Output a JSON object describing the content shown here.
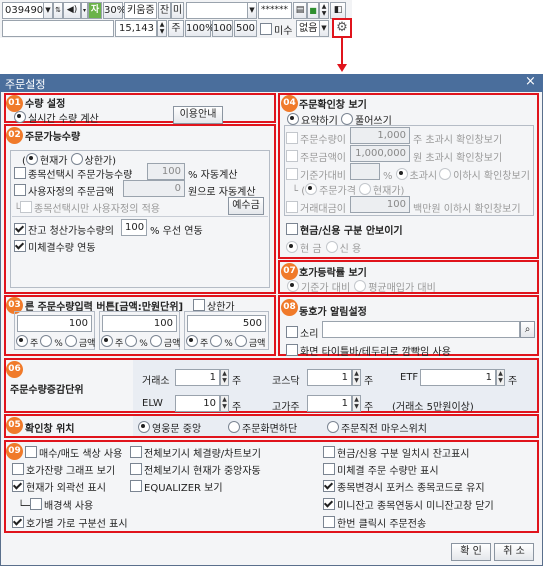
{
  "toolbar": {
    "row1": {
      "account": "039490",
      "pct": "30%",
      "order_qty_label": "키움증",
      "jan": "잔",
      "mi": "미",
      "password": "******"
    },
    "row2": {
      "qty": "15,143",
      "unit": "주",
      "pct100": "100%",
      "q100": "100",
      "q500": "500",
      "unfilled": "미수",
      "none": "없음"
    }
  },
  "dialog": {
    "title": "주문설정",
    "close": "×",
    "s01": {
      "badge": "01",
      "title": "수량 설정",
      "realtime_label": "실시간 수량 계산",
      "usage_button": "이용안내"
    },
    "s02": {
      "badge": "02",
      "title": "주문가능수량",
      "radio_cur": "현재가",
      "radio_upper": "상한가",
      "sel_stock_label": "종목선택시 주문가능수량",
      "sel_stock_value": "100",
      "sel_stock_suffix": "% 자동계산",
      "user_amount_label": "사용자정의 주문금액",
      "user_amount_value": "0",
      "user_amount_suffix": "원으로 자동계산",
      "sub_label": "종목선택시만 사용자정의 적용",
      "sub_button": "예수금",
      "liquidation_label": "잔고 청산가능수량의",
      "liquidation_value": "100",
      "liquidation_suffix": "% 우선 연동",
      "unfilled_label": "미체결수량 연동"
    },
    "s03": {
      "badge": "03",
      "title": "른 주문수량입력 버튼[금액:만원단위]",
      "upper_label": "상한가",
      "boxes": [
        {
          "value": "100",
          "opt1": "주",
          "opt2": "%",
          "opt3": "금액"
        },
        {
          "value": "100",
          "opt1": "주",
          "opt2": "%",
          "opt3": "금액"
        },
        {
          "value": "500",
          "opt1": "주",
          "opt2": "%",
          "opt3": "금액"
        }
      ]
    },
    "s04": {
      "badge": "04",
      "title": "주문확인창 보기",
      "summary": "요약하기",
      "expanded": "풀어쓰기",
      "rows": [
        {
          "label": "주문수량이",
          "value": "1,000",
          "suffix": "주 초과시 확인창보기"
        },
        {
          "label": "주문금액이",
          "value": "1,000,000",
          "suffix": "원 초과시 확인창보기"
        }
      ],
      "base_label": "기준가대비",
      "over": "초과시",
      "under": "이하시 확인창보기",
      "order_price": "주문가격",
      "current_price": "현재가",
      "trade_label": "거래대금이",
      "trade_value": "100",
      "trade_suffix": "백만원 이하시 확인창보기",
      "cash_label": "현금/신용 구분 안보이기",
      "cash": "현 금",
      "credit": "신 용"
    },
    "s07": {
      "badge": "07",
      "title": "호가등락률 보기",
      "base": "기준가 대비",
      "avg": "평균매입가 대비"
    },
    "s08": {
      "badge": "08",
      "title": "동호가 알림설정",
      "sound": "소리",
      "flash": "화면 타이틀바/테두리로 깜빡임 사용"
    },
    "s06": {
      "badge": "06",
      "title": "주문수량증감단위",
      "rows": [
        [
          {
            "label": "거래소",
            "value": "1",
            "unit": "주"
          },
          {
            "label": "코스닥",
            "value": "1",
            "unit": "주"
          },
          {
            "label": "ETF",
            "value": "1",
            "unit": "주"
          }
        ],
        [
          {
            "label": "ELW",
            "value": "10",
            "unit": "주"
          },
          {
            "label": "고가주",
            "value": "1",
            "unit": "주"
          }
        ]
      ],
      "note": "(거래소 5만원이상)"
    },
    "s05": {
      "badge": "05",
      "title": "확인창 위치",
      "center": "영웅문 중앙",
      "bottom": "주문화면하단",
      "mouse": "주문직전 마우스위치"
    },
    "s09": {
      "badge": "09",
      "col1": [
        {
          "label": "매수/매도 색상 사용",
          "checked": false
        },
        {
          "label": "호가잔량 그래프 보기",
          "checked": false
        },
        {
          "label": "현재가 외곽선 표시",
          "checked": true
        },
        {
          "label": "배경색 사용",
          "checked": false
        },
        {
          "label": "호가별 가로 구분선 표시",
          "checked": true
        }
      ],
      "col2": [
        {
          "label": "전체보기시 체결량/차트보기",
          "checked": false
        },
        {
          "label": "전체보기시 현재가 중앙자동",
          "checked": false
        },
        {
          "label": "EQUALIZER 보기",
          "checked": false
        }
      ],
      "col3": [
        {
          "label": "현금/신용 구분 일치시 잔고표시",
          "checked": false
        },
        {
          "label": "미체결 주문 수량만 표시",
          "checked": false
        },
        {
          "label": "종목변경시 포커스 종목코드로 유지",
          "checked": true
        },
        {
          "label": "미니잔고 종목연동시 미니잔고창 닫기",
          "checked": true
        },
        {
          "label": "한번 클릭시 주문전송",
          "checked": false
        }
      ]
    },
    "ok": "확 인",
    "cancel": "취 소"
  }
}
